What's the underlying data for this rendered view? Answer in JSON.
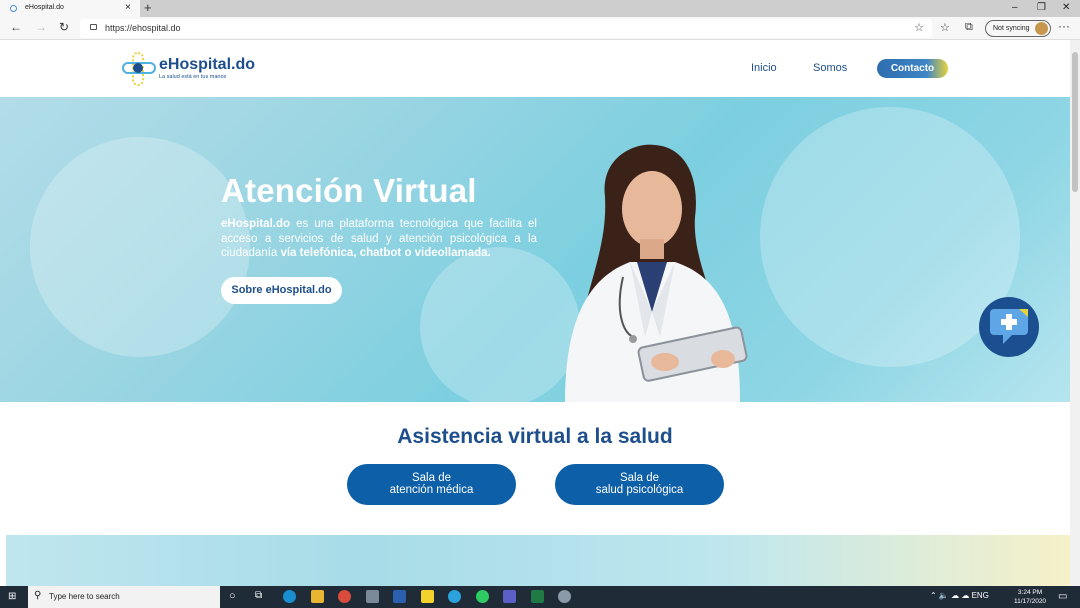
{
  "browser": {
    "tab_title": "eHospital.do",
    "url": "https://ehospital.do",
    "sync_label": "Not syncing"
  },
  "site": {
    "logo_name": "eHospital.do",
    "logo_tagline": "La salud está en tus manos",
    "nav": {
      "inicio": "Inicio",
      "somos": "Somos",
      "contacto": "Contacto"
    }
  },
  "hero": {
    "title": "Atención Virtual",
    "brand": "eHospital.do",
    "text": " es una plataforma tecnológica que facilita el acceso a servicios de salud y atención psicológica a la ciudadanía ",
    "text_bold": "vía telefónica, chatbot o videollamada.",
    "button": "Sobre eHospital.do"
  },
  "assistance": {
    "title": "Asistencia virtual a la salud",
    "button_medical_line1": "Sala de",
    "button_medical_line2": "atención médica",
    "button_psych_line1": "Sala de",
    "button_psych_line2": "salud psicológica"
  },
  "taskbar": {
    "search_placeholder": "Type here to search",
    "language": "ENG",
    "time": "3:24 PM",
    "date": "11/17/2020"
  },
  "colors": {
    "brand_blue": "#1e4f8c",
    "button_blue": "#0d5fa8",
    "accent_yellow": "#e6d23d"
  }
}
